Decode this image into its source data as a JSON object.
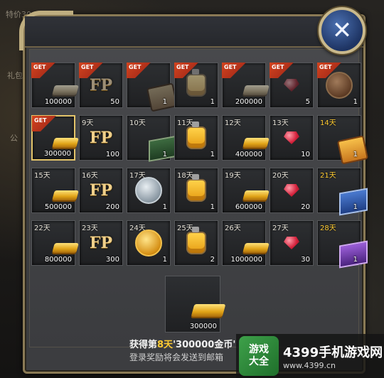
{
  "background": {
    "left_text_1": "特价30",
    "left_text_2": "礼包",
    "left_text_3": "公"
  },
  "close_button": {
    "glyph": "✕"
  },
  "rows": [
    [
      {
        "day": "",
        "qty": "100000",
        "icon": "gold-bar",
        "state": "collected"
      },
      {
        "day": "",
        "qty": "50",
        "icon": "fp",
        "state": "collected"
      },
      {
        "day": "",
        "qty": "1",
        "icon": "scroll",
        "state": "collected"
      },
      {
        "day": "",
        "qty": "1",
        "icon": "potion",
        "state": "collected"
      },
      {
        "day": "",
        "qty": "200000",
        "icon": "gold-bar",
        "state": "collected"
      },
      {
        "day": "",
        "qty": "5",
        "icon": "gem",
        "state": "collected"
      },
      {
        "day": "",
        "qty": "1",
        "icon": "coin-bronze",
        "state": "collected"
      }
    ],
    [
      {
        "day": "",
        "qty": "300000",
        "icon": "gold-bar",
        "state": "current"
      },
      {
        "day": "9天",
        "qty": "100",
        "icon": "fp",
        "state": "locked"
      },
      {
        "day": "10天",
        "qty": "1",
        "icon": "box-green",
        "state": "locked"
      },
      {
        "day": "11天",
        "qty": "1",
        "icon": "potion",
        "state": "locked"
      },
      {
        "day": "12天",
        "qty": "400000",
        "icon": "gold-bar",
        "state": "locked"
      },
      {
        "day": "13天",
        "qty": "10",
        "icon": "gem",
        "state": "locked"
      },
      {
        "day": "14天",
        "qty": "1",
        "icon": "scroll",
        "state": "locked",
        "gold_day": true
      }
    ],
    [
      {
        "day": "15天",
        "qty": "500000",
        "icon": "gold-bar",
        "state": "locked"
      },
      {
        "day": "16天",
        "qty": "200",
        "icon": "fp",
        "state": "locked"
      },
      {
        "day": "17天",
        "qty": "1",
        "icon": "coin-silver",
        "state": "locked"
      },
      {
        "day": "18天",
        "qty": "1",
        "icon": "potion",
        "state": "locked"
      },
      {
        "day": "19天",
        "qty": "600000",
        "icon": "gold-bar",
        "state": "locked"
      },
      {
        "day": "20天",
        "qty": "20",
        "icon": "gem",
        "state": "locked"
      },
      {
        "day": "21天",
        "qty": "1",
        "icon": "box-blue",
        "state": "locked",
        "gold_day": true
      }
    ],
    [
      {
        "day": "22天",
        "qty": "800000",
        "icon": "gold-bar",
        "state": "locked"
      },
      {
        "day": "23天",
        "qty": "300",
        "icon": "fp",
        "state": "locked"
      },
      {
        "day": "24天",
        "qty": "1",
        "icon": "coin-gold",
        "state": "locked"
      },
      {
        "day": "25天",
        "qty": "2",
        "icon": "potion",
        "state": "locked"
      },
      {
        "day": "26天",
        "qty": "1000000",
        "icon": "gold-bar",
        "state": "locked"
      },
      {
        "day": "27天",
        "qty": "30",
        "icon": "gem",
        "state": "locked"
      },
      {
        "day": "28天",
        "qty": "1",
        "icon": "box-purple",
        "state": "locked",
        "gold_day": true
      }
    ]
  ],
  "get_label": "GET",
  "fp_label": "FP",
  "reward": {
    "qty": "300000",
    "caption_prefix": "获得第",
    "caption_day": "8天",
    "caption_rest": "'300000金币'",
    "notice": "登录奖励将会发送到邮箱"
  },
  "watermark": {
    "logo_line1": "游戏",
    "logo_line2": "大全",
    "title": "4399手机游戏网",
    "url": "www.4399.cn"
  }
}
